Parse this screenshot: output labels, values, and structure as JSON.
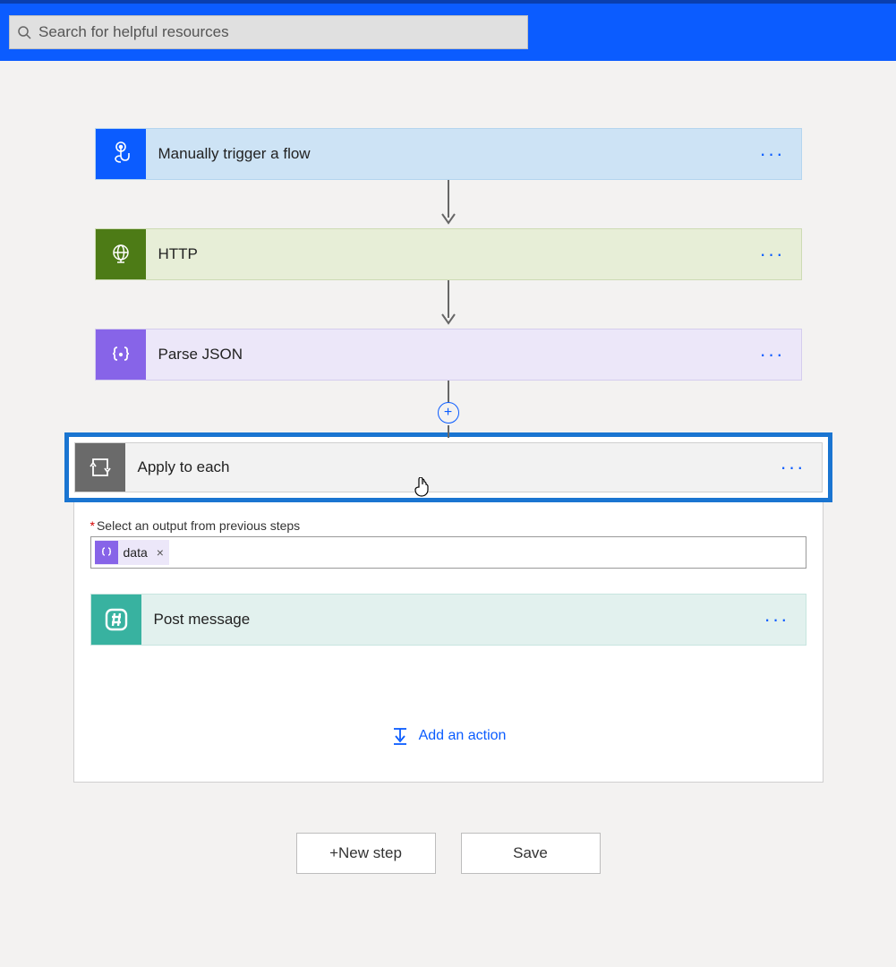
{
  "search": {
    "placeholder": "Search for helpful resources"
  },
  "steps": {
    "trigger": {
      "label": "Manually trigger a flow"
    },
    "http": {
      "label": "HTTP"
    },
    "parse_json": {
      "label": "Parse JSON"
    },
    "apply_each": {
      "label": "Apply to each",
      "select_label": "Select an output from previous steps",
      "token": {
        "name": "data",
        "close": "×"
      },
      "post_message": {
        "label": "Post message"
      },
      "add_action": "Add an action"
    }
  },
  "buttons": {
    "new_step_prefix": "+ ",
    "new_step": "New step",
    "save": "Save"
  },
  "ellipsis": "···",
  "plus": "+"
}
